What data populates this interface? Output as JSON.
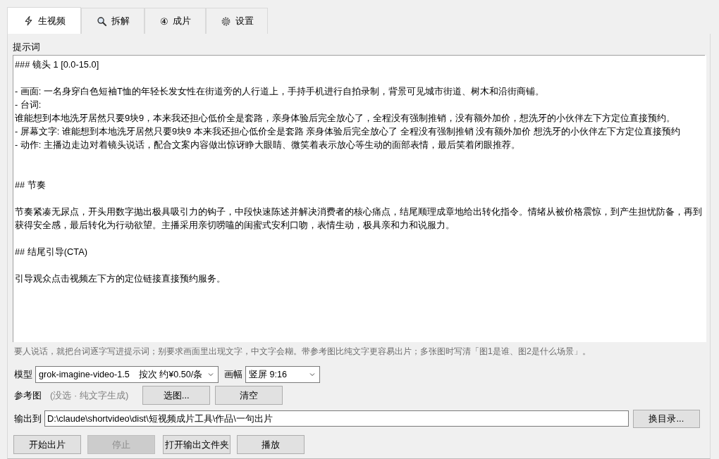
{
  "tabs": [
    {
      "label": "生视频",
      "selected": true
    },
    {
      "label": "拆解",
      "selected": false
    },
    {
      "label": "成片",
      "glyph": "④",
      "selected": false
    },
    {
      "label": "设置",
      "selected": false
    }
  ],
  "prompt": {
    "label": "提示词",
    "sections": [
      {
        "blocks": [
          [
            "### 镜头 1 [0.0-15.0]"
          ],
          [
            "- 画面: 一名身穿白色短袖T恤的年轻长发女性在街道旁的人行道上，手持手机进行自拍录制，背景可见城市街道、树木和沿街商铺。",
            "- 台词:",
            "谁能想到本地洗牙居然只要9块9，本来我还担心低价全是套路，亲身体验后完全放心了，全程没有强制推销，没有额外加价，想洗牙的小伙伴左下方定位直接预约。",
            "- 屏幕文字: 谁能想到本地洗牙居然只要9块9 本来我还担心低价全是套路 亲身体验后完全放心了 全程没有强制推销 没有额外加价 想洗牙的小伙伴左下方定位直接预约",
            "- 动作: 主播边走边对着镜头说话，配合文案内容做出惊讶睁大眼睛、微笑着表示放心等生动的面部表情，最后笑着闭眼推荐。"
          ]
        ]
      },
      {
        "blocks": [
          [
            "## 节奏"
          ],
          [
            "节奏紧凑无尿点，开头用数字抛出极具吸引力的钩子，中段快速陈述并解决消费者的核心痛点，结尾顺理成章地给出转化指令。情绪从被价格震惊，到产生担忧防备，再到获得安全感，最后转化为行动欲望。主播采用亲切唠嗑的闺蜜式安利口吻，表情生动，极具亲和力和说服力。"
          ],
          [
            "## 结尾引导(CTA)"
          ],
          [
            "引导观众点击视频左下方的定位链接直接预约服务。"
          ]
        ]
      }
    ]
  },
  "hint": "要人说话，就把台词逐字写进提示词；别要求画面里出现文字，中文字会糊。带参考图比纯文字更容易出片；多张图时写清「图1是谁、图2是什么场景」。",
  "model": {
    "label": "模型",
    "value": "grok-imagine-video-1.5　按次 约¥0.50/条"
  },
  "aspect": {
    "label": "画幅",
    "value": "竖屏 9:16"
  },
  "reference": {
    "label": "参考图",
    "status": "(没选 · 纯文字生成)",
    "buttons": [
      {
        "label": "选图...",
        "disabled": false
      },
      {
        "label": "清空",
        "disabled": false
      }
    ]
  },
  "output": {
    "label": "输出到",
    "value": "D:\\claude\\shortvideo\\dist\\短视频成片工具\\作品\\一句出片",
    "button": {
      "label": "换目录...",
      "disabled": false
    }
  },
  "actions": [
    {
      "label": "开始出片",
      "disabled": false
    },
    {
      "label": "停止",
      "disabled": true
    },
    {
      "label": "打开输出文件夹",
      "disabled": false
    },
    {
      "label": "播放",
      "disabled": false
    }
  ]
}
